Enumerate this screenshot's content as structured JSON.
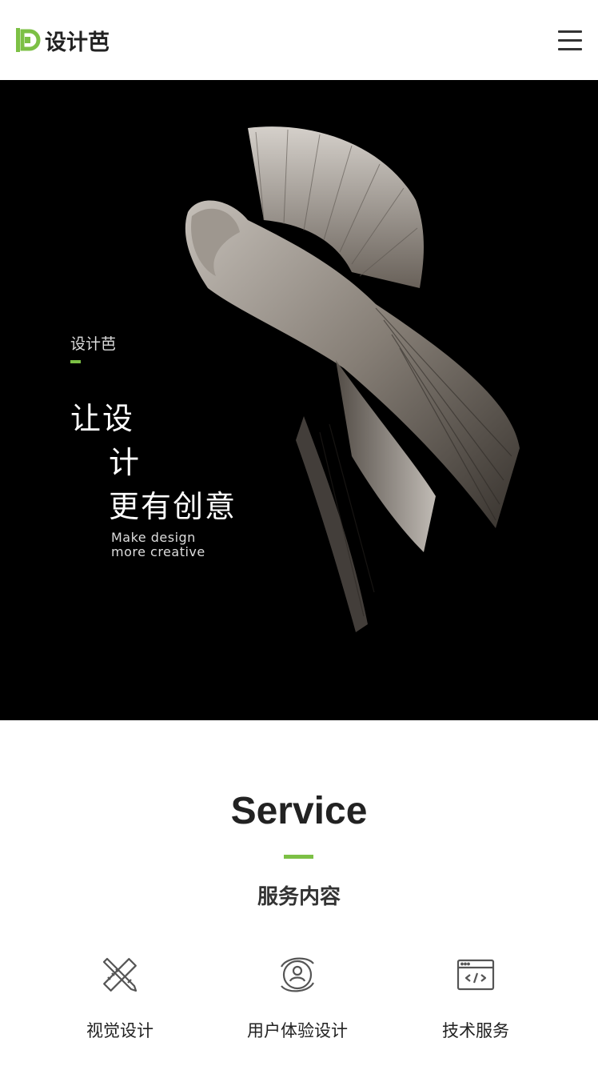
{
  "header": {
    "logo_text": "设计芭",
    "logo_icon": "logo-d-icon",
    "menu_icon": "hamburger-menu-icon",
    "accent_color": "#7cc045"
  },
  "hero": {
    "brand": "设计芭",
    "headline_1": "让设",
    "headline_2": "计",
    "headline_3": "更有创意",
    "tagline_1": "Make design",
    "tagline_2": "more creative"
  },
  "services": {
    "title": "Service",
    "subtitle": "服务内容",
    "items": [
      {
        "label": "视觉设计",
        "icon": "pencil-ruler-icon"
      },
      {
        "label": "用户体验设计",
        "icon": "user-profile-icon"
      },
      {
        "label": "技术服务",
        "icon": "code-window-icon"
      }
    ]
  }
}
